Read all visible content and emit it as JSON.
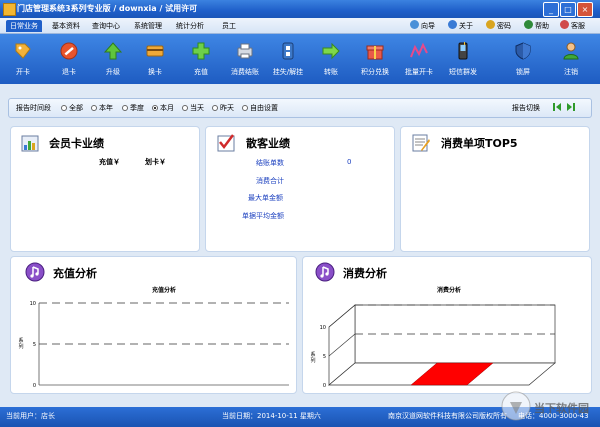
{
  "window": {
    "title": "门店管理系统3系列专业版 / downxia / 试用许可",
    "minimize": "_",
    "maximize": "□",
    "close": "×"
  },
  "menu": {
    "tabs": [
      {
        "label": "日常业务",
        "active": true
      },
      {
        "label": "基本资料"
      },
      {
        "label": "查询中心"
      },
      {
        "label": "系统管理"
      },
      {
        "label": "统计分析"
      },
      {
        "label": "员工"
      }
    ],
    "quick": [
      {
        "label": "向导",
        "icon": "wizard-icon"
      },
      {
        "label": "关于",
        "icon": "about-icon"
      },
      {
        "label": "密码",
        "icon": "password-icon"
      },
      {
        "label": "帮助",
        "icon": "help-icon"
      },
      {
        "label": "客服",
        "icon": "support-icon"
      }
    ]
  },
  "toolbar": [
    {
      "label": "开卡",
      "icon": "open-card-icon"
    },
    {
      "label": "退卡",
      "icon": "return-card-icon"
    },
    {
      "label": "升级",
      "icon": "upgrade-icon"
    },
    {
      "label": "换卡",
      "icon": "swap-card-icon"
    },
    {
      "label": "充值",
      "icon": "recharge-icon"
    },
    {
      "label": "消费结账",
      "icon": "checkout-icon"
    },
    {
      "label": "挂失/解挂",
      "icon": "report-loss-icon"
    },
    {
      "label": "转账",
      "icon": "transfer-icon"
    },
    {
      "label": "积分兑换",
      "icon": "points-redeem-icon"
    },
    {
      "label": "批量开卡",
      "icon": "batch-open-icon"
    },
    {
      "label": "短信群发",
      "icon": "sms-icon"
    },
    {
      "label": "锁屏",
      "icon": "lock-screen-icon"
    },
    {
      "label": "注销",
      "icon": "logout-icon"
    }
  ],
  "filter": {
    "label": "报告时间段",
    "options": [
      {
        "label": "全部",
        "selected": false
      },
      {
        "label": "本年",
        "selected": false
      },
      {
        "label": "季度",
        "selected": false
      },
      {
        "label": "本月",
        "selected": true
      },
      {
        "label": "当天",
        "selected": false
      },
      {
        "label": "昨天",
        "selected": false
      },
      {
        "label": "自由设置",
        "selected": false
      }
    ],
    "report_switch": "报告切换"
  },
  "member_panel": {
    "title": "会员卡业绩",
    "col_recharge": "充值￥",
    "col_swipe": "划卡￥"
  },
  "guest_panel": {
    "title": "散客业绩",
    "rows": [
      {
        "label": "结账单数",
        "value": "0"
      },
      {
        "label": "消费合计",
        "value": ""
      },
      {
        "label": "最大单金额",
        "value": ""
      },
      {
        "label": "单据平均金额",
        "value": ""
      }
    ]
  },
  "top5_panel": {
    "title": "消费单项TOP5"
  },
  "recharge_panel": {
    "title": "充值分析",
    "chart_title": "充值分析"
  },
  "consume_panel": {
    "title": "消费分析",
    "chart_title": "消费分析"
  },
  "chart_data": [
    {
      "type": "line",
      "title": "充值分析",
      "ylabel": "系\n列",
      "yticks": [
        0,
        5,
        10
      ],
      "ylim": [
        0,
        10
      ],
      "series": [],
      "grid": true
    },
    {
      "type": "bar",
      "title": "消费分析",
      "ylabel": "系\n列",
      "yticks": [
        0,
        5,
        10
      ],
      "ylim": [
        0,
        10
      ],
      "categories": [
        ""
      ],
      "values": [
        0
      ],
      "colors": [
        "#ff0000"
      ],
      "grid": true
    }
  ],
  "status": {
    "user": "当前用户：店长",
    "date": "当前日期：2014-10-11 星期六",
    "company": "南京汉道网软件科技有限公司版权所有",
    "phone": "电话：4000-3000-43",
    "watermark": "当下软件园"
  },
  "colors": {
    "accent": "#1f5fc9",
    "toolbar": "#2e71d6",
    "bar_red": "#ff0000"
  }
}
